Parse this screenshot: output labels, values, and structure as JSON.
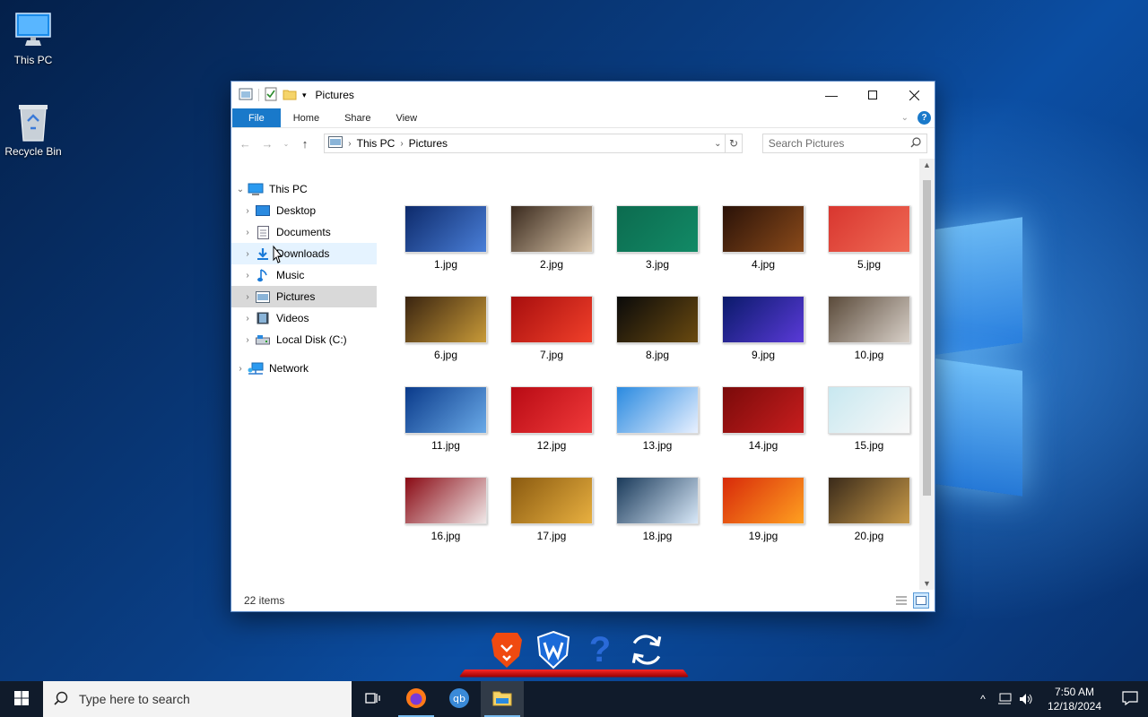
{
  "desktop": {
    "icons": [
      {
        "label": "This PC"
      },
      {
        "label": "Recycle Bin"
      }
    ]
  },
  "window": {
    "title": "Pictures",
    "ribbon_tabs": [
      "File",
      "Home",
      "Share",
      "View"
    ],
    "address": {
      "crumbs": [
        "This PC",
        "Pictures"
      ]
    },
    "search_placeholder": "Search Pictures",
    "status": "22 items"
  },
  "nav": {
    "items": [
      {
        "label": "This PC",
        "icon": "pc-icon"
      },
      {
        "label": "Desktop",
        "icon": "desktop-folder-icon"
      },
      {
        "label": "Documents",
        "icon": "documents-icon"
      },
      {
        "label": "Downloads",
        "icon": "downloads-icon"
      },
      {
        "label": "Music",
        "icon": "music-icon"
      },
      {
        "label": "Pictures",
        "icon": "pictures-icon"
      },
      {
        "label": "Videos",
        "icon": "videos-icon"
      },
      {
        "label": "Local Disk (C:)",
        "icon": "drive-icon"
      },
      {
        "label": "Network",
        "icon": "network-icon"
      }
    ]
  },
  "files": [
    {
      "name": "1.jpg",
      "colors": [
        "#0d2a6b",
        "#4a7fd8"
      ]
    },
    {
      "name": "2.jpg",
      "colors": [
        "#3a2a1e",
        "#d9c4a8"
      ]
    },
    {
      "name": "3.jpg",
      "colors": [
        "#0c6b4f",
        "#128a66"
      ]
    },
    {
      "name": "4.jpg",
      "colors": [
        "#2a1208",
        "#8a4a1a"
      ]
    },
    {
      "name": "5.jpg",
      "colors": [
        "#d8362f",
        "#f06a55"
      ]
    },
    {
      "name": "6.jpg",
      "colors": [
        "#3a2410",
        "#c89a38"
      ]
    },
    {
      "name": "7.jpg",
      "colors": [
        "#a80e0e",
        "#f0402a"
      ]
    },
    {
      "name": "8.jpg",
      "colors": [
        "#0a0a0a",
        "#6a4a10"
      ]
    },
    {
      "name": "9.jpg",
      "colors": [
        "#0a1a6a",
        "#5a3ad8"
      ]
    },
    {
      "name": "10.jpg",
      "colors": [
        "#5a4a3a",
        "#d8d0c8"
      ]
    },
    {
      "name": "11.jpg",
      "colors": [
        "#0a3a8a",
        "#6aaae8"
      ]
    },
    {
      "name": "12.jpg",
      "colors": [
        "#b80a14",
        "#f03a3a"
      ]
    },
    {
      "name": "13.jpg",
      "colors": [
        "#2a8ae0",
        "#e8f0ff"
      ]
    },
    {
      "name": "14.jpg",
      "colors": [
        "#7a0a0a",
        "#c81e1e"
      ]
    },
    {
      "name": "15.jpg",
      "colors": [
        "#c8e8f0",
        "#f8f8f8"
      ]
    },
    {
      "name": "16.jpg",
      "colors": [
        "#8a0a14",
        "#f0e8e8"
      ]
    },
    {
      "name": "17.jpg",
      "colors": [
        "#8a5a10",
        "#e8b040"
      ]
    },
    {
      "name": "18.jpg",
      "colors": [
        "#1a3a5a",
        "#d8e8f8"
      ]
    },
    {
      "name": "19.jpg",
      "colors": [
        "#d82a0a",
        "#ffa020"
      ]
    },
    {
      "name": "20.jpg",
      "colors": [
        "#3a2a1a",
        "#c89a48"
      ]
    }
  ],
  "taskbar": {
    "search_placeholder": "Type here to search",
    "time": "7:50 AM",
    "date": "12/18/2024"
  }
}
